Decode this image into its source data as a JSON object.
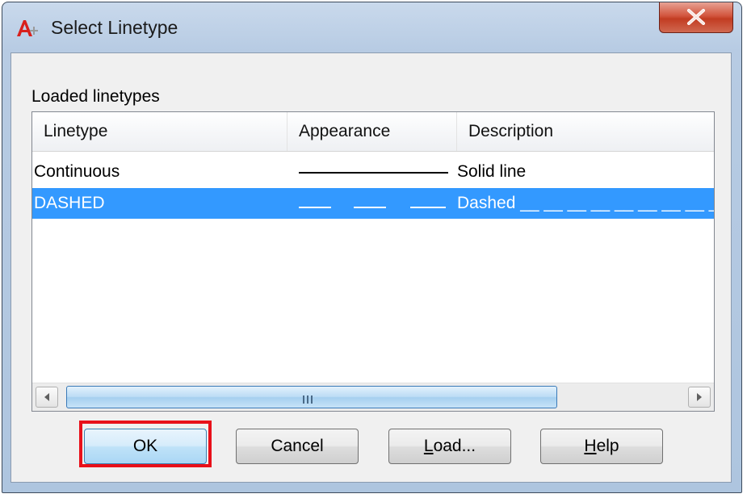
{
  "window": {
    "title": "Select Linetype",
    "close_glyph": "X",
    "app_icon": "autocad-logo-icon",
    "close_icon": "close-icon"
  },
  "group_label": "Loaded linetypes",
  "columns": [
    "Linetype",
    "Appearance",
    "Description"
  ],
  "rows": [
    {
      "linetype": "Continuous",
      "appearance": "solid",
      "description": "Solid line",
      "selected": false
    },
    {
      "linetype": "DASHED",
      "appearance": "dashed",
      "description": "Dashed __ __ __ __ __ __ __ __ _",
      "selected": true
    }
  ],
  "scrollbar": {
    "left_icon": "scroll-left-icon",
    "right_icon": "scroll-right-icon",
    "grip": "III"
  },
  "buttons": {
    "ok": "OK",
    "cancel": "Cancel",
    "load_accel": "L",
    "load_rest": "oad...",
    "help_accel": "H",
    "help_rest": "elp"
  },
  "colors": {
    "selection": "#3399ff",
    "highlight": "#e8101a",
    "close": "#c23c22"
  }
}
